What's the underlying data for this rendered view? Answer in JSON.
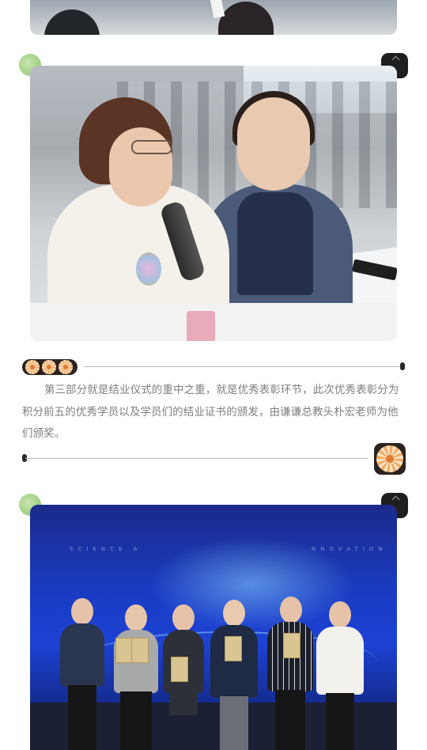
{
  "article": {
    "paragraph": "第三部分就是结业仪式的重中之重，就是优秀表彰环节，此次优秀表彰分为积分前五的优秀学员以及学员们的结业证书的颁发，由谦谦总教头朴宏老师为他们颁奖。"
  },
  "colors": {
    "text_gray": "#7d7d7d",
    "divider": "#b9b9b9",
    "accent_green": "#a7d38a",
    "sun_orange": "#f0a860"
  },
  "icons": [
    "sun-icon",
    "corner-dot-green",
    "corner-tile-black"
  ]
}
